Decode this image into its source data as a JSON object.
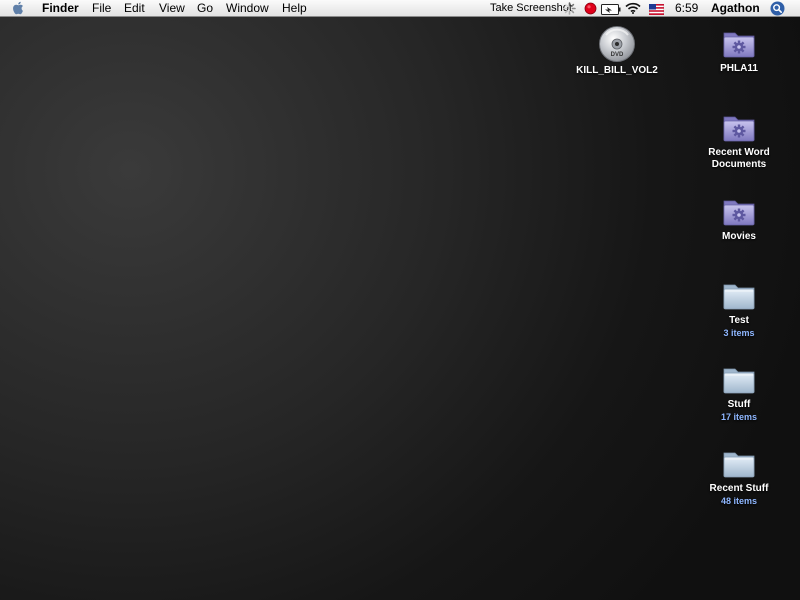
{
  "menubar": {
    "app_name": "Finder",
    "menus": [
      "File",
      "Edit",
      "View",
      "Go",
      "Window",
      "Help"
    ],
    "take_screenshot": "Take Screenshot",
    "clock": "6:59",
    "user": "Agathon",
    "icons": {
      "apple": "apple-logo-icon",
      "progress": "spinner-icon",
      "record": "record-icon",
      "battery": "battery-charging-icon",
      "wifi": "wifi-icon",
      "flag": "us-flag-icon",
      "spotlight": "spotlight-search-icon"
    }
  },
  "desktop": {
    "dvd": {
      "label": "KILL_BILL_VOL2",
      "icon": "dvd-disc-icon",
      "disc_text": "DVD"
    },
    "items": [
      {
        "label": "PHLA11",
        "sub": "",
        "icon": "smart-folder-icon"
      },
      {
        "label": "Recent Word Documents",
        "sub": "",
        "icon": "smart-folder-icon"
      },
      {
        "label": "Movies",
        "sub": "",
        "icon": "smart-folder-icon"
      },
      {
        "label": "Test",
        "sub": "3 items",
        "icon": "folder-icon"
      },
      {
        "label": "Stuff",
        "sub": "17 items",
        "icon": "folder-icon"
      },
      {
        "label": "Recent Stuff",
        "sub": "48 items",
        "icon": "folder-icon"
      }
    ]
  },
  "colors": {
    "smart_folder": "#8c86c9",
    "folder": "#b4c8dc",
    "subtext": "#8fb7ff",
    "record": "#e0001a"
  }
}
